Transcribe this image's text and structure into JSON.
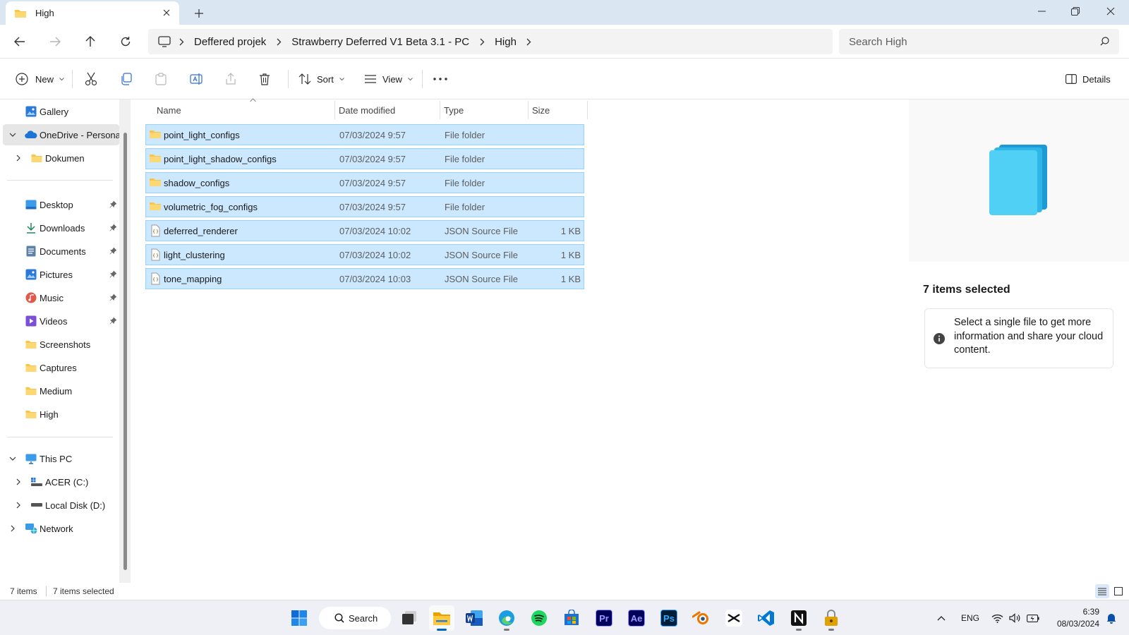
{
  "window": {
    "tab_title": "High"
  },
  "address": {
    "crumbs": [
      "Deffered projek",
      "Strawberry Deferred V1 Beta 3.1 - PC",
      "High"
    ],
    "search_placeholder": "Search High"
  },
  "toolbar": {
    "new_label": "New",
    "sort_label": "Sort",
    "view_label": "View",
    "details_label": "Details"
  },
  "sidebar": {
    "gallery": "Gallery",
    "onedrive": "OneDrive - Personal",
    "dokumen": "Dokumen",
    "quick": [
      "Desktop",
      "Downloads",
      "Documents",
      "Pictures",
      "Music",
      "Videos",
      "Screenshots",
      "Captures",
      "Medium",
      "High"
    ],
    "this_pc": "This PC",
    "acer": "ACER (C:)",
    "local_disk": "Local Disk (D:)",
    "network": "Network"
  },
  "columns": {
    "name": "Name",
    "date": "Date modified",
    "type": "Type",
    "size": "Size"
  },
  "files": [
    {
      "name": "point_light_configs",
      "date": "07/03/2024 9:57",
      "type": "File folder",
      "size": "",
      "kind": "folder"
    },
    {
      "name": "point_light_shadow_configs",
      "date": "07/03/2024 9:57",
      "type": "File folder",
      "size": "",
      "kind": "folder"
    },
    {
      "name": "shadow_configs",
      "date": "07/03/2024 9:57",
      "type": "File folder",
      "size": "",
      "kind": "folder"
    },
    {
      "name": "volumetric_fog_configs",
      "date": "07/03/2024 9:57",
      "type": "File folder",
      "size": "",
      "kind": "folder"
    },
    {
      "name": "deferred_renderer",
      "date": "07/03/2024 10:02",
      "type": "JSON Source File",
      "size": "1 KB",
      "kind": "json"
    },
    {
      "name": "light_clustering",
      "date": "07/03/2024 10:02",
      "type": "JSON Source File",
      "size": "1 KB",
      "kind": "json"
    },
    {
      "name": "tone_mapping",
      "date": "07/03/2024 10:03",
      "type": "JSON Source File",
      "size": "1 KB",
      "kind": "json"
    }
  ],
  "details_pane": {
    "title": "7 items selected",
    "message": "Select a single file to get more information and share your cloud content."
  },
  "status": {
    "count": "7 items",
    "selected": "7 items selected"
  },
  "taskbar": {
    "search_label": "Search",
    "app_labels": {
      "premiere": "Pr",
      "after_effects": "Ae",
      "photoshop": "Ps"
    },
    "language": "ENG",
    "time": "6:39",
    "date": "08/03/2024"
  },
  "colors": {
    "selection_fill": "#cce8ff",
    "selection_border": "#99d1ff",
    "folder_yellow": "#f8c545",
    "accent_blue": "#0067c0"
  }
}
